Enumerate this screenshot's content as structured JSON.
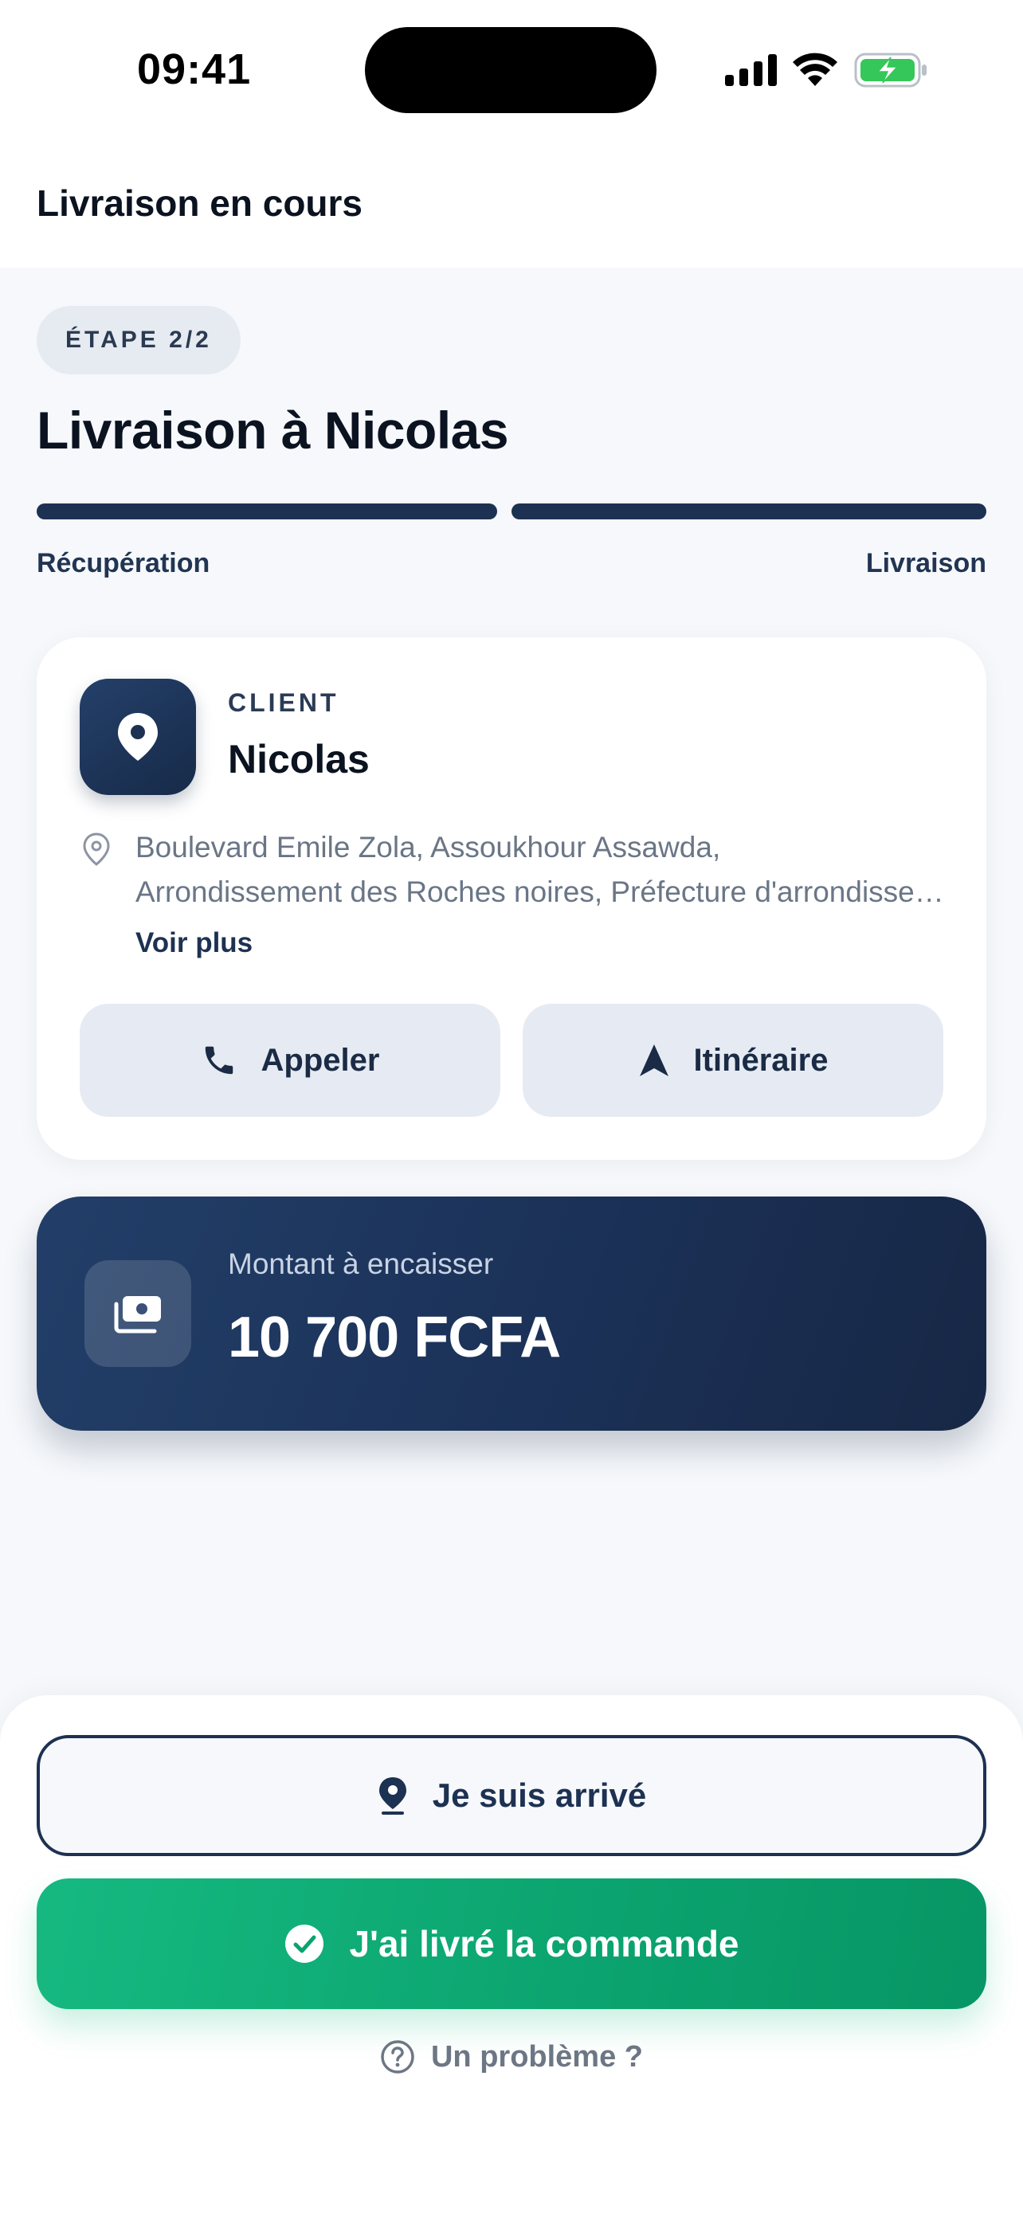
{
  "status_bar": {
    "time": "09:41",
    "icons": [
      "signal-icon",
      "wifi-icon",
      "battery-charging-icon"
    ]
  },
  "header": {
    "title": "Livraison en cours"
  },
  "step": {
    "chip": "ÉTAPE 2/2",
    "title": "Livraison à Nicolas",
    "progress_labels": [
      "Récupération",
      "Livraison"
    ],
    "progress_segments_complete": 2,
    "progress_segments_total": 2
  },
  "client": {
    "label": "CLIENT",
    "name": "Nicolas",
    "address_line1": "Boulevard Emile Zola, Assoukhour Assawda,",
    "address_line2": "Arrondissement des Roches noires, Préfecture d'arrondissement",
    "see_more": "Voir plus",
    "call_label": "Appeler",
    "route_label": "Itinéraire",
    "icons": [
      "map-pin-icon",
      "location-outline-icon",
      "phone-icon",
      "navigation-arrow-icon"
    ]
  },
  "amount": {
    "label": "Montant à encaisser",
    "value": "10 700 FCFA",
    "icon": "cash-icon"
  },
  "actions": {
    "arrived_label": "Je suis arrivé",
    "delivered_label": "J'ai livré la commande",
    "problem_label": "Un problème ?"
  },
  "colors": {
    "primary": "#1d3152",
    "success": "#10b981",
    "muted": "#6a7686",
    "surface": "#e6ebf3"
  }
}
